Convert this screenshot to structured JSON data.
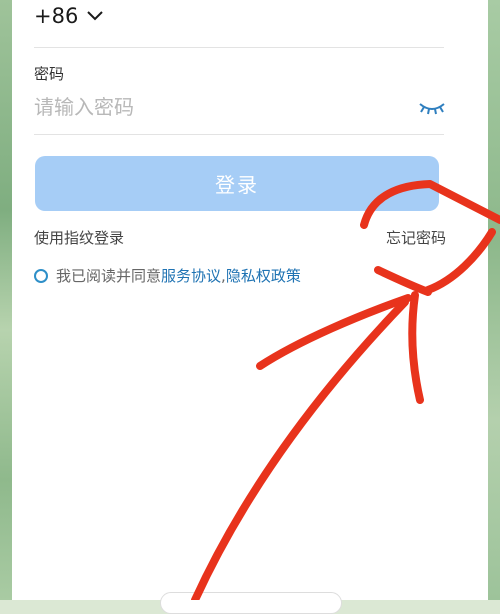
{
  "country_code": {
    "value": "+86",
    "icon": "chevron-down-icon"
  },
  "password": {
    "label": "密码",
    "placeholder": "请输入密码",
    "visibility_icon": "eye-closed-icon"
  },
  "login_button": {
    "label": "登录"
  },
  "links": {
    "fingerprint_login": "使用指纹登录",
    "forgot_password": "忘记密码"
  },
  "agreement": {
    "prefix": "我已阅读并同意",
    "service": "服务协议",
    "separator": ", ",
    "privacy": "隐私权政策"
  },
  "colors": {
    "login_button_bg": "#a6cdf6",
    "link_blue": "#1f73b3",
    "radio_ring": "#2e8fc8",
    "annotation_red": "#e8331c"
  }
}
